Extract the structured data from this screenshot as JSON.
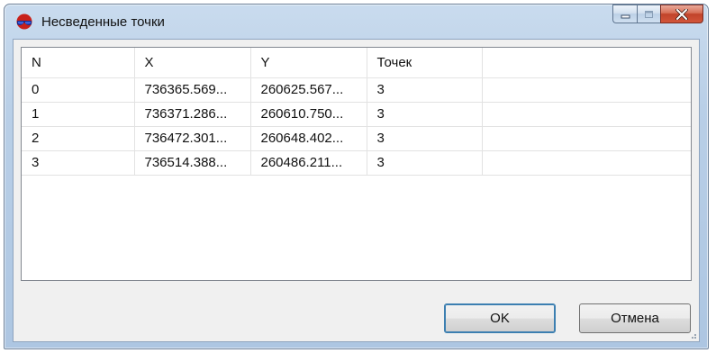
{
  "window": {
    "title": "Несведенные точки"
  },
  "table": {
    "columns": [
      "N",
      "X",
      "Y",
      "Точек",
      ""
    ],
    "rows": [
      [
        "0",
        "736365.569...",
        "260625.567...",
        "3",
        ""
      ],
      [
        "1",
        "736371.286...",
        "260610.750...",
        "3",
        ""
      ],
      [
        "2",
        "736472.301...",
        "260648.402...",
        "3",
        ""
      ],
      [
        "3",
        "736514.388...",
        "260486.211...",
        "3",
        ""
      ]
    ]
  },
  "buttons": {
    "ok": "OK",
    "cancel": "Отмена"
  },
  "icons": {
    "app": "glasses-app-icon",
    "minimize": "minimize-icon",
    "maximize": "maximize-icon",
    "close": "close-icon"
  }
}
